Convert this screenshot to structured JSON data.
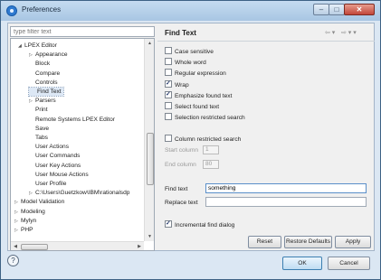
{
  "window": {
    "title": "Preferences"
  },
  "filter": {
    "placeholder": "type filter text"
  },
  "tree": [
    {
      "label": "LPEX Editor",
      "indent": 1,
      "twisty": "◢"
    },
    {
      "label": "Appearance",
      "indent": 2,
      "twisty": "▷"
    },
    {
      "label": "Block",
      "indent": 2,
      "twisty": ""
    },
    {
      "label": "Compare",
      "indent": 2,
      "twisty": ""
    },
    {
      "label": "Controls",
      "indent": 2,
      "twisty": ""
    },
    {
      "label": "Find Text",
      "indent": 2,
      "twisty": "",
      "selected": true
    },
    {
      "label": "Parsers",
      "indent": 2,
      "twisty": "▷"
    },
    {
      "label": "Print",
      "indent": 2,
      "twisty": ""
    },
    {
      "label": "Remote Systems LPEX Editor",
      "indent": 2,
      "twisty": ""
    },
    {
      "label": "Save",
      "indent": 2,
      "twisty": ""
    },
    {
      "label": "Tabs",
      "indent": 2,
      "twisty": ""
    },
    {
      "label": "User Actions",
      "indent": 2,
      "twisty": ""
    },
    {
      "label": "User Commands",
      "indent": 2,
      "twisty": ""
    },
    {
      "label": "User Key Actions",
      "indent": 2,
      "twisty": ""
    },
    {
      "label": "User Mouse Actions",
      "indent": 2,
      "twisty": ""
    },
    {
      "label": "User Profile",
      "indent": 2,
      "twisty": ""
    },
    {
      "label": "C:\\Users\\Guetzkow\\IBM\\rationalsdp",
      "indent": 2,
      "twisty": "▷"
    },
    {
      "label": "Model Validation",
      "indent": 0,
      "twisty": "▷"
    },
    {
      "label": "Modeling",
      "indent": 0,
      "twisty": "▷"
    },
    {
      "label": "Mylyn",
      "indent": 0,
      "twisty": "▷"
    },
    {
      "label": "PHP",
      "indent": 0,
      "twisty": "▷"
    }
  ],
  "page": {
    "title": "Find Text",
    "nav_back": "⇦ ▾",
    "nav_forward": "⇨ ▾ ▾",
    "options": [
      {
        "label": "Case sensitive",
        "checked": false
      },
      {
        "label": "Whole word",
        "checked": false
      },
      {
        "label": "Regular expression",
        "checked": false
      },
      {
        "label": "Wrap",
        "checked": true
      },
      {
        "label": "Emphasize found text",
        "checked": true
      },
      {
        "label": "Select found text",
        "checked": false
      },
      {
        "label": "Selection restricted search",
        "checked": false
      }
    ],
    "column_restricted": {
      "label": "Column restricted search",
      "checked": false
    },
    "start_column": {
      "label": "Start column",
      "value": "1"
    },
    "end_column": {
      "label": "End column",
      "value": "80"
    },
    "find_text": {
      "label": "Find text",
      "value": "something"
    },
    "replace_text": {
      "label": "Replace text",
      "value": ""
    },
    "incremental": {
      "label": "Incremental find dialog",
      "checked": true
    },
    "reset_label": "Reset",
    "restore_label": "Restore Defaults",
    "apply_label": "Apply"
  },
  "dialog": {
    "ok_label": "OK",
    "cancel_label": "Cancel",
    "help_glyph": "?"
  },
  "titlebar": {
    "min_glyph": "–",
    "max_glyph": "□",
    "close_glyph": "✕"
  },
  "scroll": {
    "up": "▲",
    "down": "▼",
    "left": "◀",
    "right": "▶"
  },
  "colors": {
    "accent": "#3c7fb1",
    "title_bar": "#a8c6e3",
    "selection": "#dde8f5"
  }
}
